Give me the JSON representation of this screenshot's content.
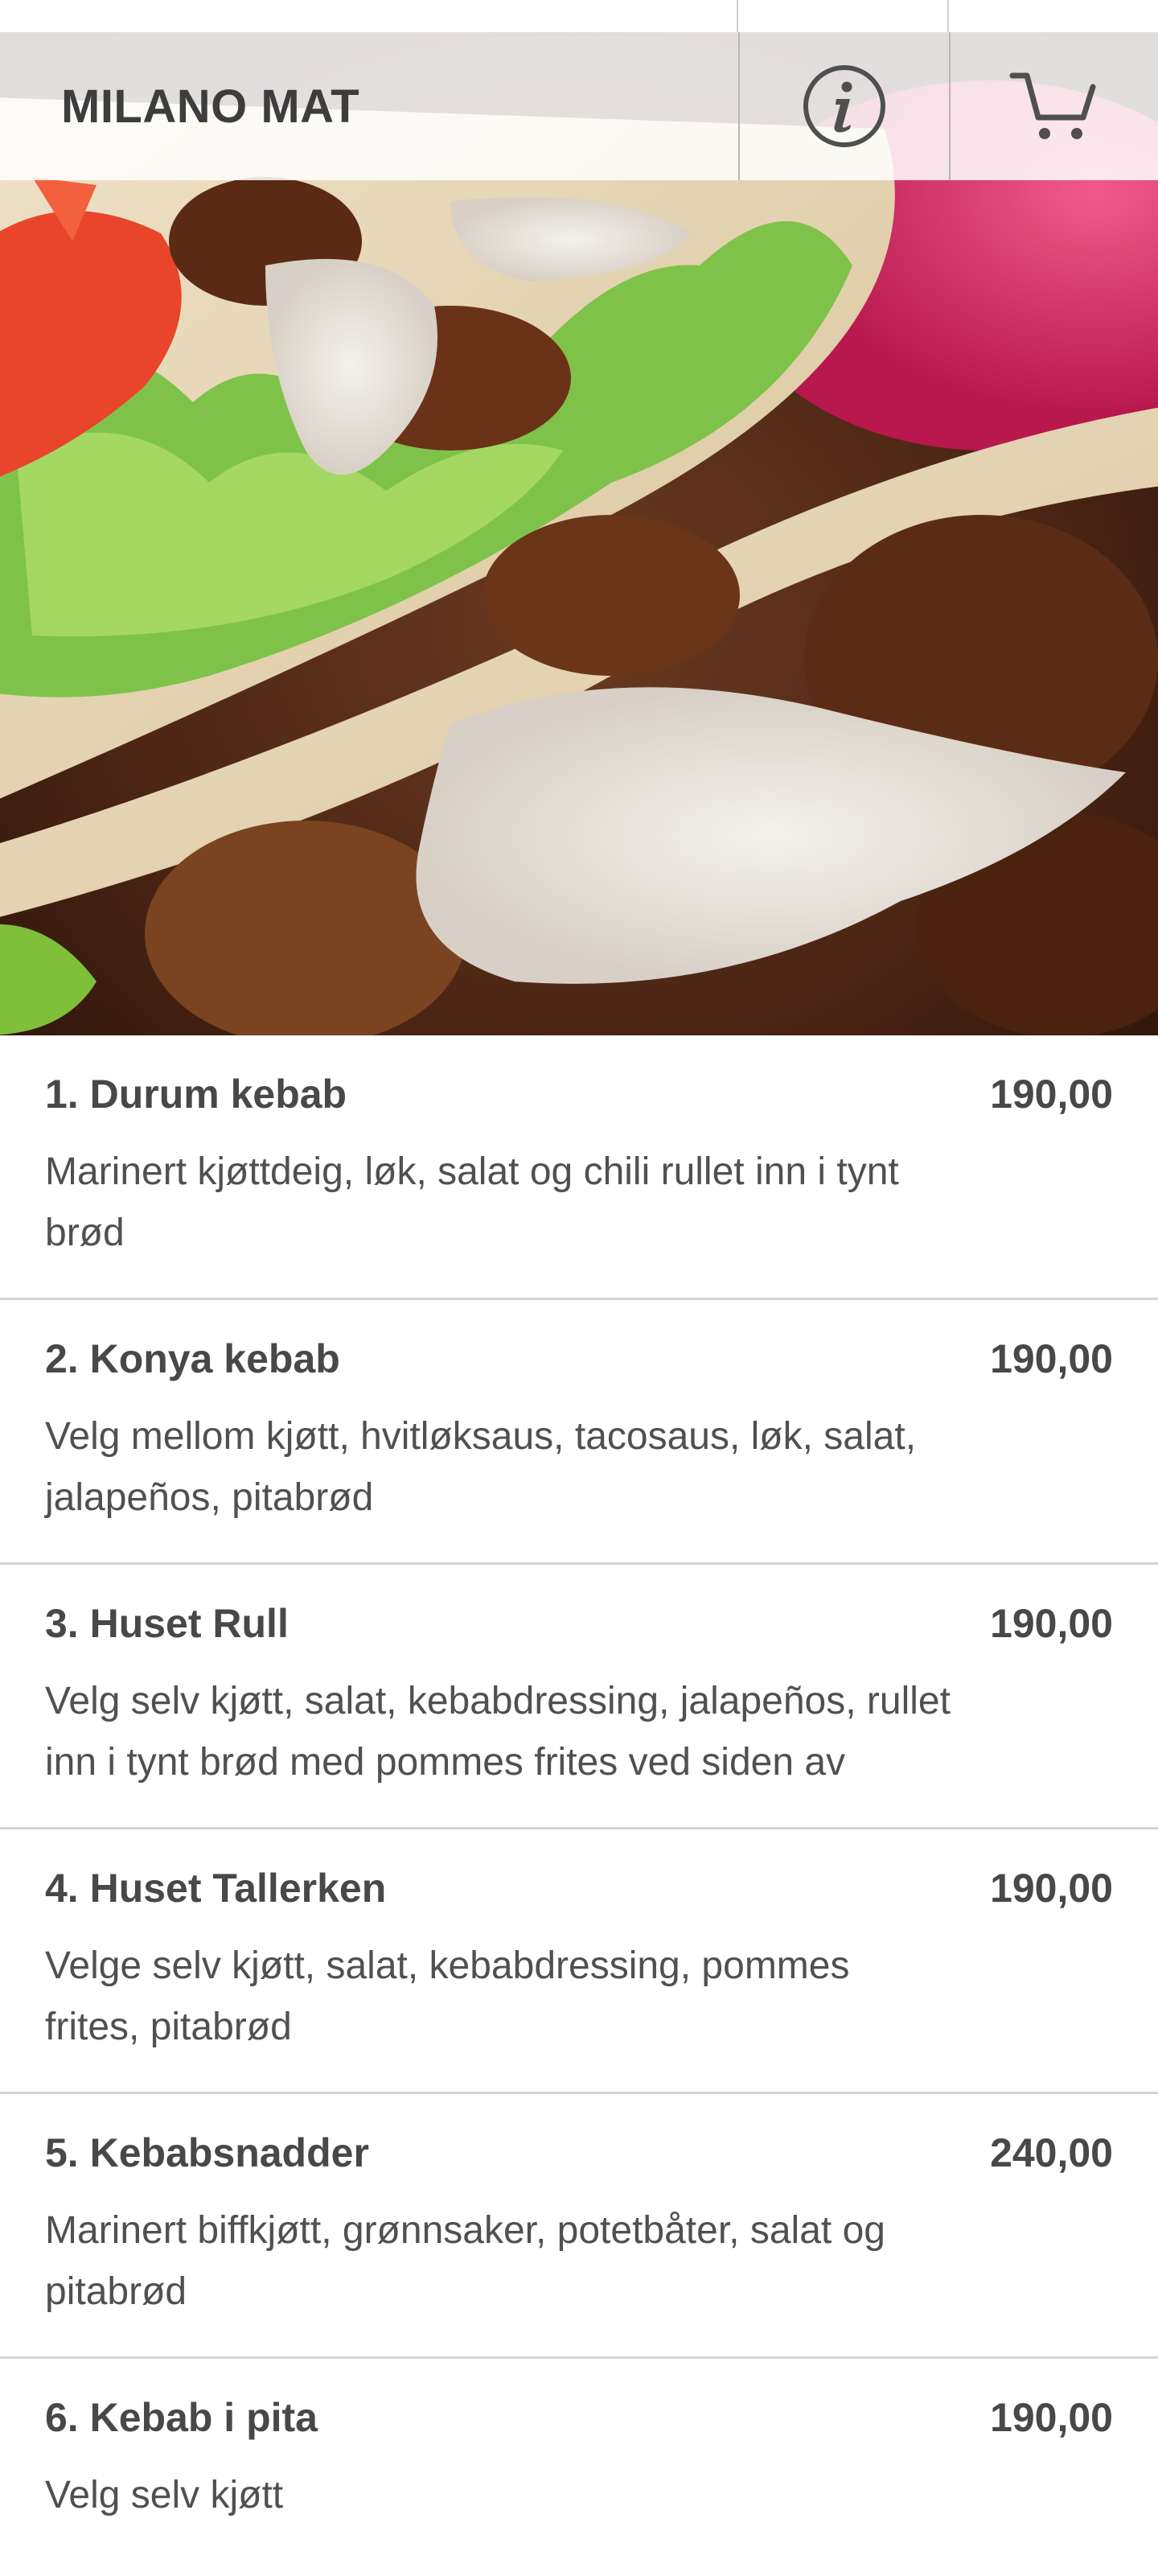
{
  "header": {
    "brand": "MILANO MAT",
    "info_icon": "info-icon",
    "cart_icon": "cart-icon"
  },
  "hero": {
    "image": "durum-kebab-photo"
  },
  "menu": {
    "items": [
      {
        "name": "1. Durum kebab",
        "price": "190,00",
        "description": "Marinert kjøttdeig, løk, salat og chili rullet inn i tynt brød"
      },
      {
        "name": "2. Konya kebab",
        "price": "190,00",
        "description": "Velg mellom kjøtt, hvitløksaus, tacosaus, løk, salat, jalapeños, pitabrød"
      },
      {
        "name": "3. Huset Rull",
        "price": "190,00",
        "description": "Velg selv kjøtt, salat, kebabdressing, jalapeños, rullet inn i tynt brød med pommes frites ved siden av"
      },
      {
        "name": "4. Huset Tallerken",
        "price": "190,00",
        "description": "Velge selv kjøtt, salat, kebabdressing, pommes frites, pitabrød"
      },
      {
        "name": "5. Kebabsnadder",
        "price": "240,00",
        "description": "Marinert biffkjøtt, grønnsaker, potetbåter, salat og pitabrød"
      },
      {
        "name": "6. Kebab i pita",
        "price": "190,00",
        "description": "Velg selv kjøtt"
      }
    ]
  }
}
